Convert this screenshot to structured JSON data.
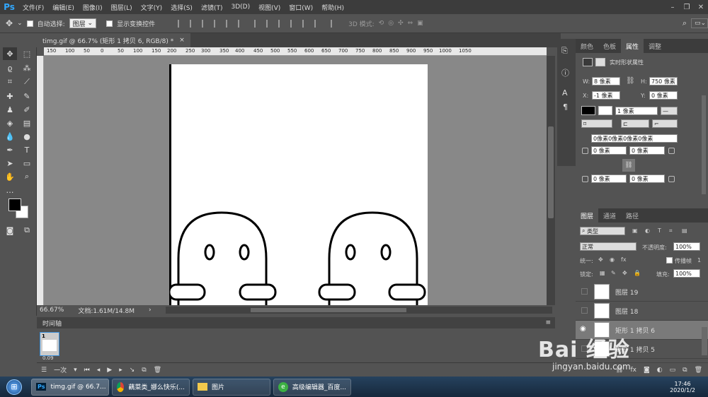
{
  "app": {
    "logo": "Ps"
  },
  "menu": [
    "文件(F)",
    "编辑(E)",
    "图像(I)",
    "图层(L)",
    "文字(Y)",
    "选择(S)",
    "滤镜(T)",
    "3D(D)",
    "视图(V)",
    "窗口(W)",
    "帮助(H)"
  ],
  "options": {
    "auto_select_label": "自动选择:",
    "auto_select_value": "图层",
    "show_transform_label": "显示变换控件",
    "mode_label": "3D 模式:"
  },
  "document": {
    "tab_title": "timg.gif @ 66.7% (矩形 1 拷贝 6, RGB/8) *",
    "close": "×"
  },
  "ruler": {
    "h_ticks": [
      "150",
      "100",
      "50",
      "0",
      "50",
      "100",
      "150",
      "200",
      "250",
      "300",
      "350",
      "400",
      "450",
      "500",
      "550",
      "600",
      "650",
      "700",
      "750",
      "800",
      "850",
      "900",
      "950",
      "1000",
      "1050"
    ]
  },
  "status": {
    "zoom": "66.67%",
    "doc": "文档:1.61M/14.8M"
  },
  "timeline": {
    "title": "时间轴",
    "frame_number": "1",
    "frame_delay": "0.09",
    "loop": "一次"
  },
  "panels": {
    "top_tabs": [
      "颜色",
      "色板",
      "属性",
      "调整"
    ],
    "props_title": "实时形状属性",
    "w_label": "W:",
    "w_value": "8 像素",
    "h_label": "H:",
    "h_value": "750 像素",
    "x_label": "X:",
    "x_value": "-1 像素",
    "y_label": "Y:",
    "y_value": "0 像素",
    "stroke_value": "1 像素",
    "corners_all": "0像素0像素0像素0像素",
    "corner_tl": "0 像素",
    "corner_tr": "0 像素",
    "corner_bl": "0 像素",
    "corner_br": "0 像素"
  },
  "layers": {
    "tabs": [
      "图层",
      "通道",
      "路径"
    ],
    "filter": "类型",
    "blend": "正常",
    "opacity_label": "不透明度:",
    "opacity": "100%",
    "unify_label": "统一:",
    "propagate_label": "传播帧",
    "propagate_value": "1",
    "lock_label": "锁定:",
    "fill_label": "填充:",
    "fill": "100%",
    "items": [
      {
        "name": "图层 19"
      },
      {
        "name": "图层 18"
      },
      {
        "name": "矩形 1 拷贝 6"
      },
      {
        "name": "矩形 1 拷贝 5"
      }
    ]
  },
  "taskbar": {
    "items": [
      "timg.gif @ 66.7...",
      "藕菜类_娜么快乐(...",
      "图片",
      "高级编辑器_百度..."
    ],
    "time": "17:46",
    "date": "2020/1/2"
  },
  "watermark": {
    "main": "Bai 经验",
    "sub": "jingyan.baidu.com"
  }
}
